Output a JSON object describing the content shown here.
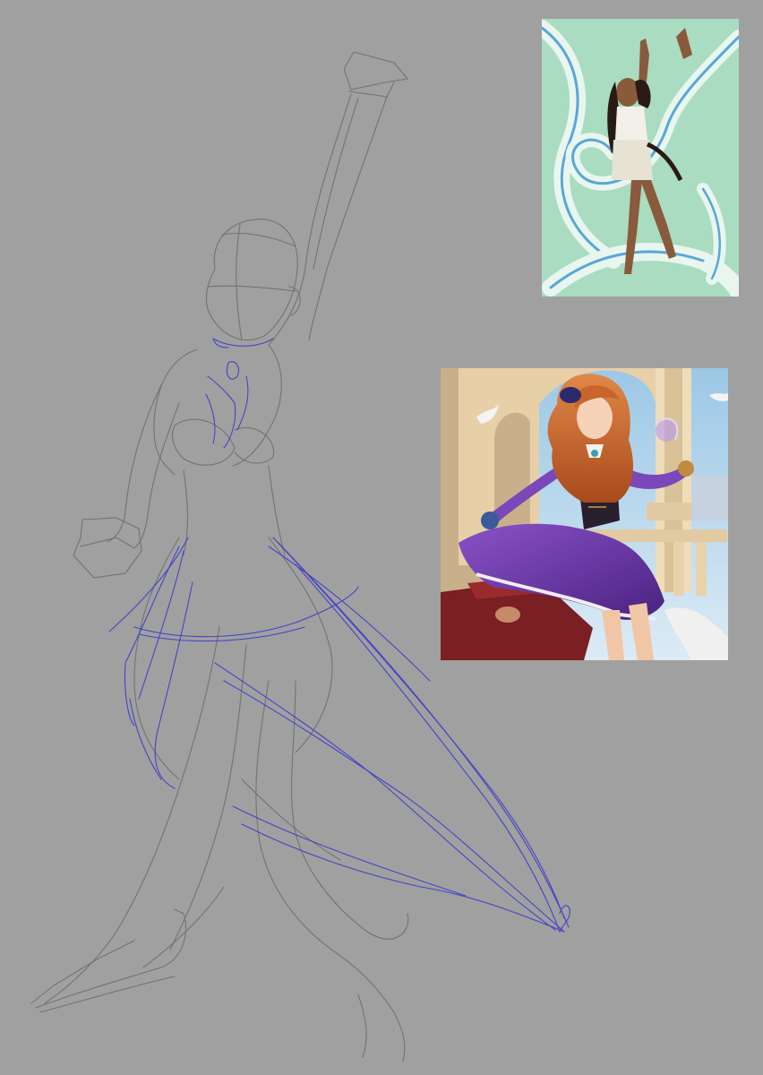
{
  "canvas": {
    "background": "#a0a0a0",
    "sketch_pencil_color": "#6a6a6a",
    "sketch_construction_color": "#3a3ac8"
  },
  "references": [
    {
      "name": "reference-dancer-water",
      "palette": {
        "background": "#a9dcc0",
        "water": "#5aa6d8",
        "skin": "#8a5a3c",
        "outfit": "#f2f0e8"
      }
    },
    {
      "name": "reference-purple-dress-character",
      "palette": {
        "sky": "#b9d6ea",
        "dress": "#6a36a8",
        "hair": "#c9652a",
        "architecture": "#e7cfa8",
        "foreground": "#7a1f22"
      }
    }
  ]
}
